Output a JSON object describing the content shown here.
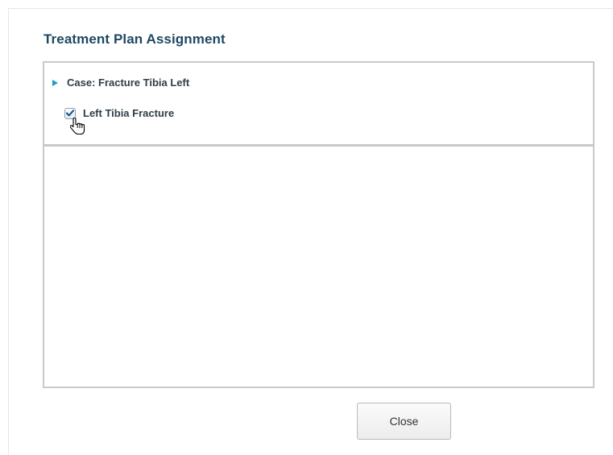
{
  "dialog": {
    "title": "Treatment Plan Assignment",
    "case": {
      "label": "Case: Fracture Tibia Left",
      "expanded": false,
      "diagnoses": [
        {
          "label": "Left Tibia Fracture",
          "checked": true
        }
      ]
    },
    "close_label": "Close"
  },
  "icons": {
    "expand": "triangle-right-icon",
    "checkbox": "checkmark-icon",
    "cursor": "hand-pointer-cursor-icon"
  },
  "colors": {
    "title": "#1d4862",
    "accent": "#1f9cc9",
    "text": "#2f3d46",
    "panel_border": "#c9c9c9",
    "check": "#1e5a8a"
  }
}
